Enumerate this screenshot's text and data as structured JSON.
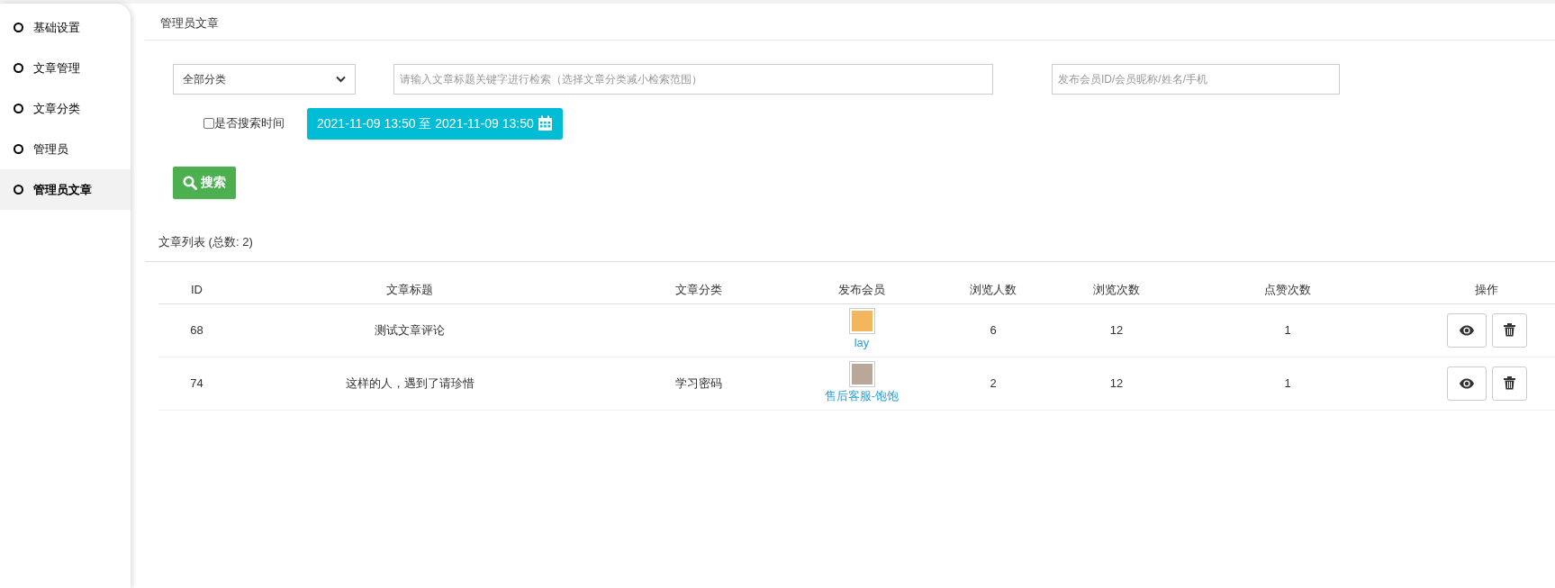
{
  "sidebar": {
    "items": [
      {
        "label": "基础设置",
        "selected": false
      },
      {
        "label": "文章管理",
        "selected": false
      },
      {
        "label": "文章分类",
        "selected": false
      },
      {
        "label": "管理员",
        "selected": false
      },
      {
        "label": "管理员文章",
        "selected": true
      }
    ]
  },
  "page_title": "管理员文章",
  "filters": {
    "category_select": {
      "value": "全部分类"
    },
    "keyword_field": {
      "placeholder": "请输入文章标题关键字进行检索（选择文章分类减小检索范围）"
    },
    "member_field": {
      "placeholder": "发布会员ID/会员昵称/姓名/手机"
    },
    "time_checkbox": {
      "label": "是否搜索时间",
      "checked": false
    },
    "date_range": "2021-11-09 13:50 至 2021-11-09 13:50",
    "search_button": "搜索"
  },
  "list_title": "文章列表 (总数: 2)",
  "table": {
    "columns": [
      "ID",
      "文章标题",
      "文章分类",
      "发布会员",
      "浏览人数",
      "浏览次数",
      "点赞次数",
      "操作"
    ],
    "rows": [
      {
        "id": "68",
        "title": "测试文章评论",
        "category": "",
        "member": "lay",
        "viewers": "6",
        "views": "12",
        "likes": "1"
      },
      {
        "id": "74",
        "title": "这样的人，遇到了请珍惜",
        "category": "学习密码",
        "member": "售后客服-饱饱",
        "viewers": "2",
        "views": "12",
        "likes": "1"
      }
    ]
  }
}
